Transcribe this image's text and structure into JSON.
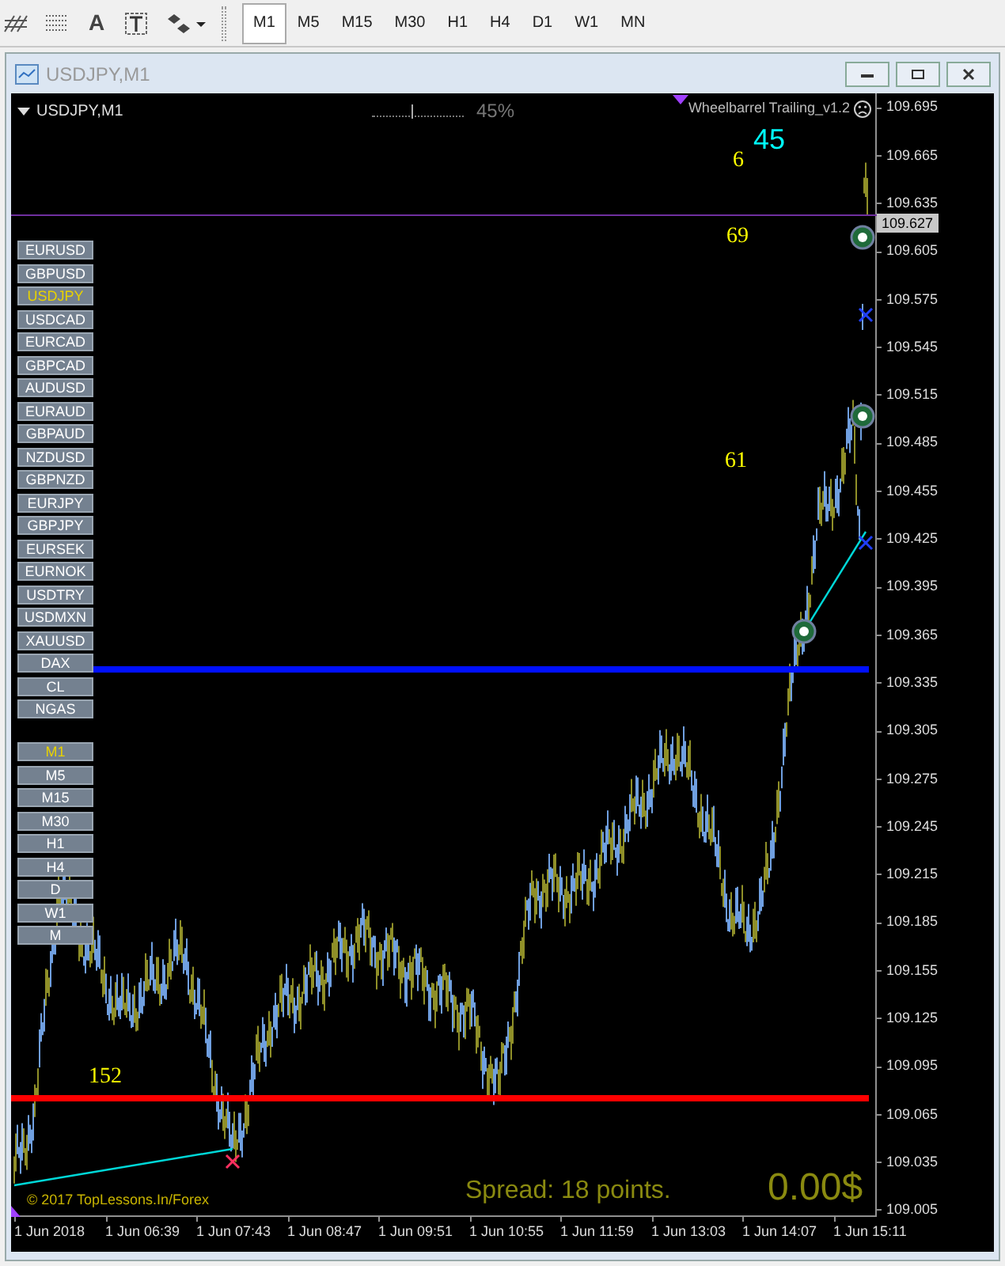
{
  "toolbar": {
    "text_tool": "A",
    "timeframes": [
      {
        "label": "M1",
        "selected": true
      },
      {
        "label": "M5",
        "selected": false
      },
      {
        "label": "M15",
        "selected": false
      },
      {
        "label": "M30",
        "selected": false
      },
      {
        "label": "H1",
        "selected": false
      },
      {
        "label": "H4",
        "selected": false
      },
      {
        "label": "D1",
        "selected": false
      },
      {
        "label": "W1",
        "selected": false
      },
      {
        "label": "MN",
        "selected": false
      }
    ]
  },
  "window": {
    "title": "USDJPY,M1"
  },
  "chart": {
    "symbol_label": "USDJPY,M1",
    "progress": "45%",
    "indicator_name": "Wheelbarrel Trailing_v1.2",
    "labels": [
      {
        "text": "6",
        "color": "#ffff00"
      },
      {
        "text": "45",
        "color": "#00ffff"
      },
      {
        "text": "69",
        "color": "#ffff00"
      },
      {
        "text": "61",
        "color": "#ffff00"
      },
      {
        "text": "152",
        "color": "#ffff00"
      }
    ],
    "symbols": [
      {
        "label": "EURUSD",
        "selected": false
      },
      {
        "label": "GBPUSD",
        "selected": false
      },
      {
        "label": "USDJPY",
        "selected": true
      },
      {
        "label": "USDCAD",
        "selected": false
      },
      {
        "label": "EURCAD",
        "selected": false
      },
      {
        "label": "GBPCAD",
        "selected": false
      },
      {
        "label": "AUDUSD",
        "selected": false
      },
      {
        "label": "EURAUD",
        "selected": false
      },
      {
        "label": "GBPAUD",
        "selected": false
      },
      {
        "label": "NZDUSD",
        "selected": false
      },
      {
        "label": "GBPNZD",
        "selected": false
      },
      {
        "label": "EURJPY",
        "selected": false
      },
      {
        "label": "GBPJPY",
        "selected": false
      },
      {
        "label": "EURSEK",
        "selected": false
      },
      {
        "label": "EURNOK",
        "selected": false
      },
      {
        "label": "USDTRY",
        "selected": false
      },
      {
        "label": "USDMXN",
        "selected": false
      },
      {
        "label": "XAUUSD",
        "selected": false
      },
      {
        "label": "DAX",
        "selected": false
      },
      {
        "label": "CL",
        "selected": false
      },
      {
        "label": "NGAS",
        "selected": false
      }
    ],
    "timeframes": [
      {
        "label": "M1",
        "selected": true
      },
      {
        "label": "M5",
        "selected": false
      },
      {
        "label": "M15",
        "selected": false
      },
      {
        "label": "M30",
        "selected": false
      },
      {
        "label": "H1",
        "selected": false
      },
      {
        "label": "H4",
        "selected": false
      },
      {
        "label": "D",
        "selected": false
      },
      {
        "label": "W1",
        "selected": false
      },
      {
        "label": "M",
        "selected": false
      }
    ],
    "copyright": "© 2017 TopLessons.In/Forex",
    "spread": "Spread: 18 points.",
    "profit": "0.00$",
    "price_axis": [
      "109.695",
      "109.665",
      "109.635",
      "109.605",
      "109.575",
      "109.545",
      "109.515",
      "109.485",
      "109.455",
      "109.425",
      "109.395",
      "109.365",
      "109.335",
      "109.305",
      "109.275",
      "109.245",
      "109.215",
      "109.185",
      "109.155",
      "109.125",
      "109.095",
      "109.065",
      "109.035",
      "109.005"
    ],
    "current_price": "109.627",
    "time_axis": [
      "1 Jun 2018",
      "1 Jun 06:39",
      "1 Jun 07:43",
      "1 Jun 08:47",
      "1 Jun 09:51",
      "1 Jun 10:55",
      "1 Jun 11:59",
      "1 Jun 13:03",
      "1 Jun 14:07",
      "1 Jun 15:11"
    ]
  }
}
